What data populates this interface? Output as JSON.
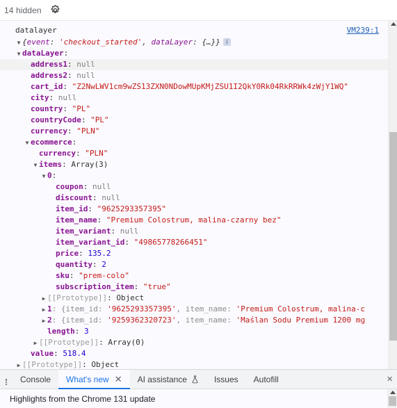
{
  "toolbar": {
    "hidden_label": "14 hidden",
    "settings_icon": "gear-icon"
  },
  "console": {
    "message_label": "datalayer",
    "source_link": "VM239:1",
    "summary": {
      "open_brace": "{",
      "event_key": "event",
      "event_sep": ": ",
      "event_value": "'checkout_started'",
      "comma": ", ",
      "datalayer_key": "dataLayer",
      "datalayer_value": "{…}",
      "close_brace": "}",
      "info_badge": "i"
    },
    "rows": [
      {
        "indent": 1,
        "tri": "open",
        "key": "dataLayer",
        "sep": ":",
        "value": "",
        "vtype": "none",
        "hl": false
      },
      {
        "indent": 2,
        "tri": "none",
        "key": "address1",
        "sep": ": ",
        "value": "null",
        "vtype": "null",
        "hl": true
      },
      {
        "indent": 2,
        "tri": "none",
        "key": "address2",
        "sep": ": ",
        "value": "null",
        "vtype": "null",
        "hl": false
      },
      {
        "indent": 2,
        "tri": "none",
        "key": "cart_id",
        "sep": ": ",
        "value": "\"Z2NwLWV1cm9wZS13ZXN0NDowMUpKMjZSU1I2QkY0Rk04RkRRWk4zWjY1WQ\"",
        "vtype": "str",
        "hl": false
      },
      {
        "indent": 2,
        "tri": "none",
        "key": "city",
        "sep": ": ",
        "value": "null",
        "vtype": "null",
        "hl": false
      },
      {
        "indent": 2,
        "tri": "none",
        "key": "country",
        "sep": ": ",
        "value": "\"PL\"",
        "vtype": "str",
        "hl": false
      },
      {
        "indent": 2,
        "tri": "none",
        "key": "countryCode",
        "sep": ": ",
        "value": "\"PL\"",
        "vtype": "str",
        "hl": false
      },
      {
        "indent": 2,
        "tri": "none",
        "key": "currency",
        "sep": ": ",
        "value": "\"PLN\"",
        "vtype": "str",
        "hl": false
      },
      {
        "indent": 2,
        "tri": "open",
        "key": "ecommerce",
        "sep": ":",
        "value": "",
        "vtype": "none",
        "hl": false
      },
      {
        "indent": 3,
        "tri": "none",
        "key": "currency",
        "sep": ": ",
        "value": "\"PLN\"",
        "vtype": "str",
        "hl": false
      },
      {
        "indent": 3,
        "tri": "open",
        "key": "items",
        "sep": ": ",
        "value": "Array(3)",
        "vtype": "obj",
        "hl": false
      },
      {
        "indent": 4,
        "tri": "open",
        "key": "0",
        "sep": ":",
        "value": "",
        "vtype": "none",
        "hl": false
      },
      {
        "indent": 5,
        "tri": "none",
        "key": "coupon",
        "sep": ": ",
        "value": "null",
        "vtype": "null",
        "hl": false
      },
      {
        "indent": 5,
        "tri": "none",
        "key": "discount",
        "sep": ": ",
        "value": "null",
        "vtype": "null",
        "hl": false
      },
      {
        "indent": 5,
        "tri": "none",
        "key": "item_id",
        "sep": ": ",
        "value": "\"9625293357395\"",
        "vtype": "str",
        "hl": false
      },
      {
        "indent": 5,
        "tri": "none",
        "key": "item_name",
        "sep": ": ",
        "value": "\"Premium Colostrum, malina-czarny bez\"",
        "vtype": "str",
        "hl": false
      },
      {
        "indent": 5,
        "tri": "none",
        "key": "item_variant",
        "sep": ": ",
        "value": "null",
        "vtype": "null",
        "hl": false
      },
      {
        "indent": 5,
        "tri": "none",
        "key": "item_variant_id",
        "sep": ": ",
        "value": "\"49865778266451\"",
        "vtype": "str",
        "hl": false
      },
      {
        "indent": 5,
        "tri": "none",
        "key": "price",
        "sep": ": ",
        "value": "135.2",
        "vtype": "num",
        "hl": false
      },
      {
        "indent": 5,
        "tri": "none",
        "key": "quantity",
        "sep": ": ",
        "value": "2",
        "vtype": "num",
        "hl": false
      },
      {
        "indent": 5,
        "tri": "none",
        "key": "sku",
        "sep": ": ",
        "value": "\"prem-colo\"",
        "vtype": "str",
        "hl": false
      },
      {
        "indent": 5,
        "tri": "none",
        "key": "subscription_item",
        "sep": ": ",
        "value": "\"true\"",
        "vtype": "str",
        "hl": false
      },
      {
        "indent": 4,
        "tri": "closed",
        "key": "[[Prototype]]",
        "sep": ": ",
        "value": "Object",
        "vtype": "proto",
        "hl": false
      }
    ],
    "preview_rows": [
      {
        "indent": 4,
        "index": "1",
        "text": ": {item_id: '9625293357395', item_name: 'Premium Colostrum, malina-c"
      },
      {
        "indent": 4,
        "index": "2",
        "text": ": {item_id: '9259362320723', item_name: 'Maślan Sodu Premium 1200 mɡ"
      }
    ],
    "tail_rows": [
      {
        "indent": 4,
        "tri": "none",
        "key": "length",
        "sep": ": ",
        "value": "3",
        "vtype": "num",
        "hl": false
      },
      {
        "indent": 3,
        "tri": "closed",
        "key": "[[Prototype]]",
        "sep": ": ",
        "value": "Array(0)",
        "vtype": "proto",
        "hl": false
      },
      {
        "indent": 2,
        "tri": "none",
        "key": "value",
        "sep": ": ",
        "value": "518.4",
        "vtype": "num",
        "hl": false
      },
      {
        "indent": 1,
        "tri": "closed",
        "key": "[[Prototype]]",
        "sep": ": ",
        "value": "Object",
        "vtype": "proto",
        "hl": false
      }
    ]
  },
  "drawer": {
    "menu_icon": "more-options-icon",
    "tabs": [
      {
        "label": "Console",
        "active": false,
        "closable": false,
        "icon": ""
      },
      {
        "label": "What's new",
        "active": true,
        "closable": true,
        "icon": ""
      },
      {
        "label": "AI assistance",
        "active": false,
        "closable": false,
        "icon": "flask-icon"
      },
      {
        "label": "Issues",
        "active": false,
        "closable": false,
        "icon": ""
      },
      {
        "label": "Autofill",
        "active": false,
        "closable": false,
        "icon": ""
      }
    ],
    "close_label": "×",
    "tab_close_label": "✕",
    "content_text": "Highlights from the Chrome 131 update"
  },
  "colors": {
    "accent": "#1a73e8",
    "key": "#881391",
    "string": "#c41a16",
    "number": "#1c00cf",
    "null": "#808080",
    "link": "#1a5fb4",
    "console_bg": "#fbfaff"
  }
}
